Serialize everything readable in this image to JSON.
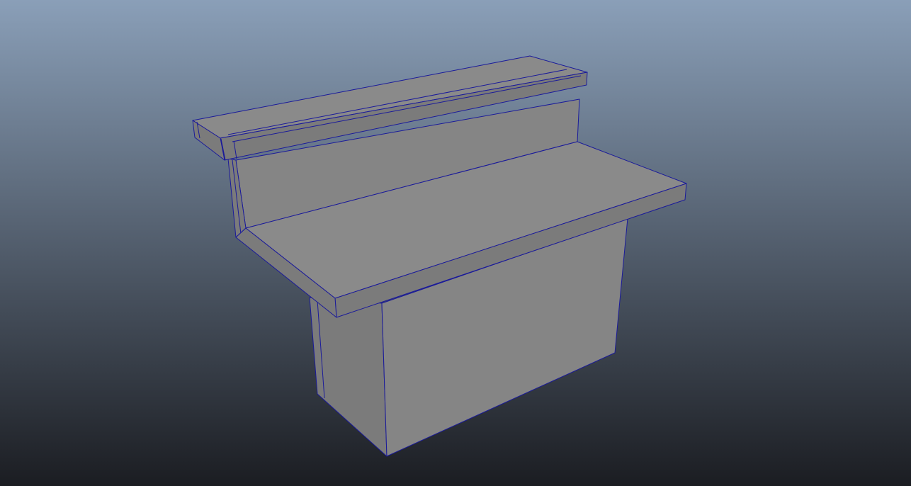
{
  "viewport": {
    "background_top": "#8a9fb8",
    "background_bottom": "#1b1d22"
  },
  "model": {
    "face_light": "#8a8a8a",
    "face_mid": "#858585",
    "face_dark": "#7b7b7b",
    "wire_color": "#1a1a9a"
  }
}
